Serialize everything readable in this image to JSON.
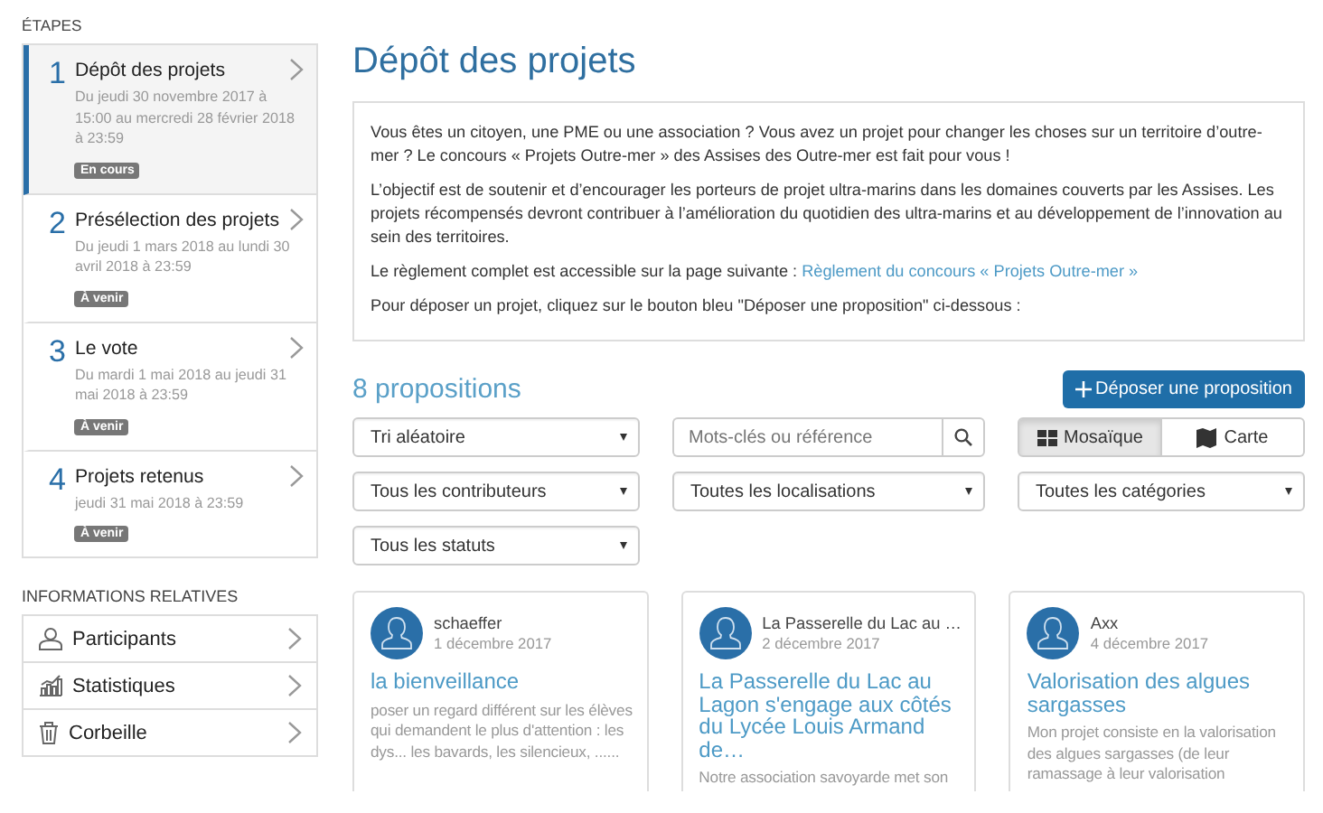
{
  "sidebar": {
    "steps_heading": "ÉTAPES",
    "steps": [
      {
        "number": "1",
        "title": "Dépôt des projets",
        "dates": "Du jeudi 30 novembre 2017 à 15:00 au mercredi 28 février 2018 à 23:59",
        "status": "En cours",
        "selected": true
      },
      {
        "number": "2",
        "title": "Présélection des projets",
        "dates": "Du jeudi 1 mars 2018 au lundi 30 avril 2018 à 23:59",
        "status": "À venir",
        "selected": false
      },
      {
        "number": "3",
        "title": "Le vote",
        "dates": "Du mardi 1 mai 2018 au jeudi 31 mai 2018 à 23:59",
        "status": "À venir",
        "selected": false
      },
      {
        "number": "4",
        "title": "Projets retenus",
        "dates": "jeudi 31 mai 2018 à 23:59",
        "status": "À venir",
        "selected": false
      }
    ],
    "info_heading": "INFORMATIONS RELATIVES",
    "info_items": [
      {
        "label": "Participants",
        "kind": "participants"
      },
      {
        "label": "Statistiques",
        "kind": "statistics"
      },
      {
        "label": "Corbeille",
        "kind": "trash"
      }
    ]
  },
  "main": {
    "title": "Dépôt des projets",
    "intro": [
      {
        "text": "Vous êtes un citoyen, une PME ou une association ? Vous avez un projet pour changer les choses sur un territoire d’outre-mer ? Le concours « Projets Outre-mer » des Assises des Outre-mer est fait pour vous !"
      },
      {
        "text": "L’objectif est de soutenir et d’encourager les porteurs de projet ultra-marins dans les domaines couverts par les Assises. Les projets récompensés devront contribuer à l’amélioration du quotidien des ultra-marins et au développement de l’innovation au sein des territoires."
      },
      {
        "text": "Le règlement complet est accessible sur la page suivante :",
        "link": "Règlement du concours « Projets Outre-mer »"
      },
      {
        "text": "Pour déposer un projet, cliquez sur le bouton bleu \"Déposer une proposition\" ci-dessous :"
      }
    ],
    "count": "8 propositions",
    "submit_button": "Déposer une proposition",
    "sort_select": "Tri aléatoire",
    "search": {
      "placeholder": "Mots-clés ou référence"
    },
    "view_toggle": [
      {
        "label": "Mosaïque",
        "kind": "grid",
        "selected": true
      },
      {
        "label": "Carte",
        "kind": "map",
        "selected": false
      }
    ],
    "filters": [
      "Tous les contributeurs",
      "Toutes les localisations",
      "Toutes les catégories",
      "Tous les statuts"
    ],
    "cards": [
      {
        "author": "schaeffer",
        "date": "1 décembre 2017",
        "title": "la bienveillance",
        "excerpt": "poser un regard différent sur les élèves qui demandent le plus d'attention : les dys... les bavards, les silencieux, ......"
      },
      {
        "author": "La Passerelle du Lac au …",
        "date": "2 décembre 2017",
        "title": "La Passerelle du Lac au Lagon s'engage aux côtés du Lycée Louis Armand de…",
        "excerpt": "Notre association savoyarde met son"
      },
      {
        "author": "Axx",
        "date": "4 décembre 2017",
        "title": "Valorisation des algues sargasses",
        "excerpt": "Mon projet consiste en la valorisation des algues sargasses (de leur ramassage à leur valorisation"
      }
    ]
  }
}
